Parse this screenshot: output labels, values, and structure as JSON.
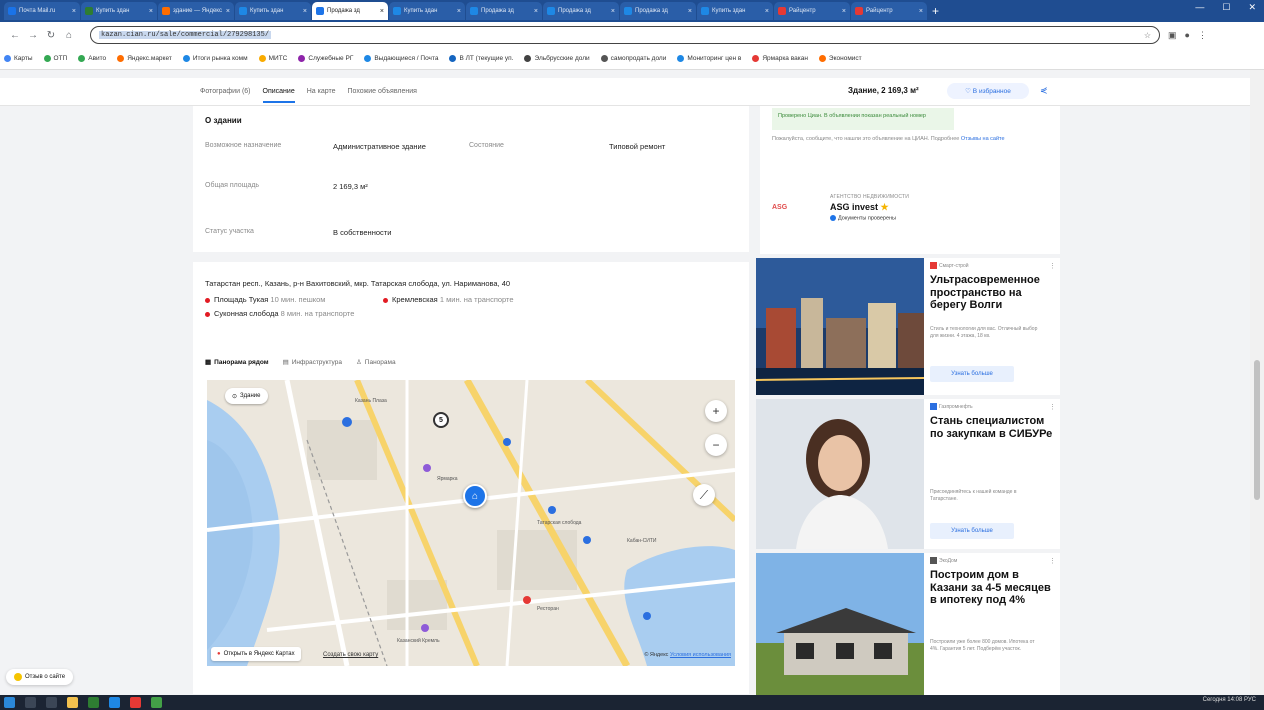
{
  "browser": {
    "tabs": [
      {
        "label": "Почта Mail.ru",
        "color": "#1a73e8",
        "active": false
      },
      {
        "label": "Купить здан",
        "color": "#2e7d32",
        "active": false
      },
      {
        "label": "здание — Яндекс",
        "color": "#ff6d00",
        "active": false
      },
      {
        "label": "Купить здан",
        "color": "#1e88e5",
        "active": false
      },
      {
        "label": "Продажа зд",
        "color": "#1d74e8",
        "active": true
      },
      {
        "label": "Купить здан",
        "color": "#1e88e5",
        "active": false
      },
      {
        "label": "Продажа зд",
        "color": "#1e88e5",
        "active": false
      },
      {
        "label": "Продажа зд",
        "color": "#1e88e5",
        "active": false
      },
      {
        "label": "Продажа зд",
        "color": "#1e88e5",
        "active": false
      },
      {
        "label": "Купить здан",
        "color": "#1e88e5",
        "active": false
      },
      {
        "label": "Райцентр",
        "color": "#e53935",
        "active": false
      },
      {
        "label": "Райцентр",
        "color": "#e53935",
        "active": false
      }
    ],
    "url": "kazan.cian.ru/sale/commercial/279298135/",
    "bookmarks": [
      "Карты",
      "ОТП",
      "Авито",
      "Яндекс.маркет",
      "Итоги рынка комм",
      "МИТС",
      "Служебные РГ",
      "Выдающиеся / Почта",
      "В ЛТ (текущие уп.",
      "Эльбрусские доли",
      "самопродать доли",
      "Мониторинг цен в",
      "Ярмарка вакан",
      "Экономист"
    ]
  },
  "header": {
    "tabs": [
      "Фотографии (6)",
      "Описание",
      "На карте",
      "Похожие объявления"
    ],
    "active_tab": "Описание",
    "area": "Здание, 2 169,3 м²",
    "favorite_label": "В избранное"
  },
  "about": {
    "title": "О здании",
    "purpose_label": "Возможное назначение",
    "purpose_value": "Административное здание",
    "condition_label": "Состояние",
    "condition_value": "Типовой ремонт",
    "area_label": "Общая площадь",
    "area_value": "2 169,3 м²",
    "land_label": "Статус участка",
    "land_value": "В собственности"
  },
  "location": {
    "address": "Татарстан респ., Казань, р-н Вахитовский, мкр. Татарская слобода, ул. Нариманова, 40",
    "metro": [
      {
        "name": "Площадь Тукая",
        "time": "10 мин. пешком"
      },
      {
        "name": "Кремлевская",
        "time": "1 мин. на транспорте"
      },
      {
        "name": "Суконная слобода",
        "time": "8 мин. на транспорте"
      }
    ]
  },
  "map": {
    "tabs": [
      "Панорама рядом",
      "Инфраструктура",
      "Панорама"
    ],
    "building_chip": "Здание",
    "cluster_count": "5",
    "open_label": "Открыть в Яндекс Картах",
    "create_label": "Создать свою карту",
    "copyright": "© Яндекс",
    "terms": "Условия использования",
    "places": [
      "Казань Плаза",
      "Татарская слобода",
      "Ярмарка",
      "Кабан-СИТИ",
      "Старо-Татарская слобода",
      "Дом Шамиля",
      "Ресторан",
      "Казанский Кремль"
    ]
  },
  "right": {
    "green_note": "Проверено Циан.  В объявлении показан реальный номер",
    "small_text": "Пожалуйста, сообщите, что нашли это объявление на ЦИАН. Подробнее",
    "small_link": "Отзывы на сайте",
    "agency_label": "АГЕНТСТВО НЕДВИЖИМОСТИ",
    "agency_logo": "ASG",
    "agency_name": "ASG invest",
    "agency_verified": "Документы проверены"
  },
  "ads": [
    {
      "source": "Смарт-строй",
      "title": "Ультрасовременное пространство на берегу Волги",
      "desc": "Стиль и технологии для вас. Отличный выбор для жизни. 4 этажа, 18 кв.",
      "button": "Узнать больше"
    },
    {
      "source": "Газпромнефть",
      "title": "Стань специалистом по закупкам в СИБУРе",
      "desc": "Присоединяйтесь к нашей команде в Татарстане.",
      "button": "Узнать больше"
    },
    {
      "source": "ЭкоДом",
      "title": "Построим дом в Казани за 4-5 месяцев в ипотеку под 4%",
      "desc": "Построили уже более 800 домов. Ипотека от 4%. Гарантия 5 лет. Подберём участок.",
      "button": ""
    }
  ],
  "feedback": "Отзыв о сайте",
  "tray_text": "Сегодня 14:08  РУС",
  "colors": {
    "accent": "#1d74e8",
    "tab_strip": "#1f4d91",
    "metro_red": "#e21b23"
  }
}
